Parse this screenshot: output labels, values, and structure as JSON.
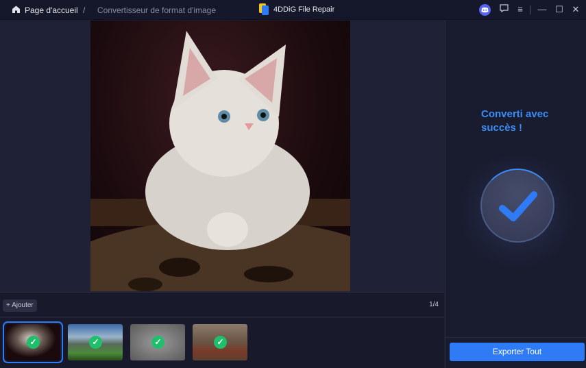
{
  "titlebar": {
    "home_label": "Page d'accueil",
    "separator": "/",
    "breadcrumb_current": "Convertisseur de format d'image",
    "app_title": "4DDiG File Repair"
  },
  "toolbar": {
    "add_label": "+ Ajouter",
    "page_counter": "1/4"
  },
  "thumbnails": [
    {
      "name": "kitten",
      "status": "done",
      "selected": true
    },
    {
      "name": "mountain",
      "status": "done",
      "selected": false
    },
    {
      "name": "gray-cat",
      "status": "done",
      "selected": false
    },
    {
      "name": "tart",
      "status": "done",
      "selected": false
    }
  ],
  "result": {
    "message": "Converti avec succès !",
    "export_label": "Exporter Tout"
  },
  "colors": {
    "accent": "#2f7bf5",
    "success": "#1fbf6c",
    "message": "#3a8cf6"
  }
}
